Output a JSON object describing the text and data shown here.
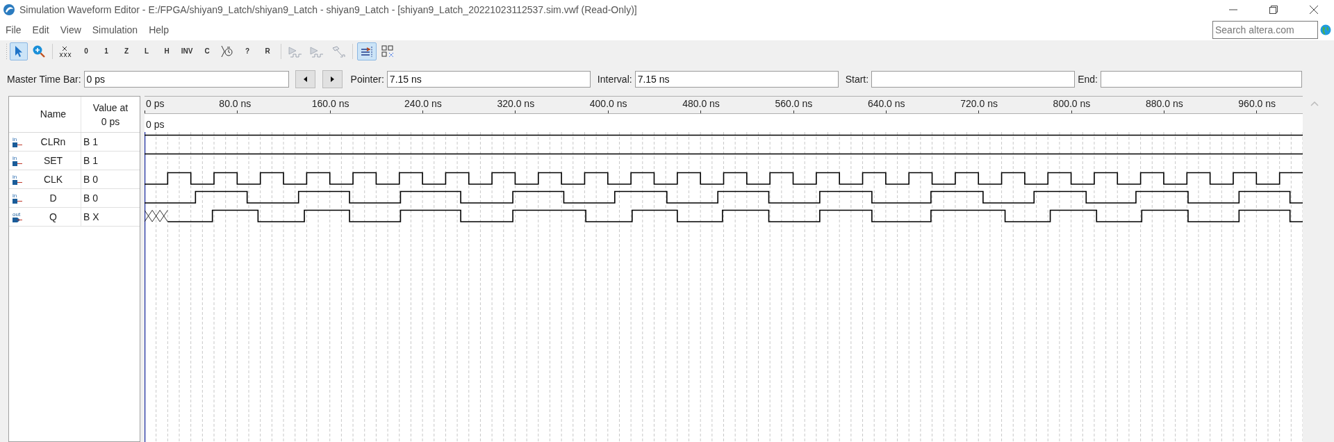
{
  "window": {
    "title": "Simulation Waveform Editor - E:/FPGA/shiyan9_Latch/shiyan9_Latch - shiyan9_Latch - [shiyan9_Latch_20221023112537.sim.vwf (Read-Only)]"
  },
  "menu": [
    "File",
    "Edit",
    "View",
    "Simulation",
    "Help"
  ],
  "search": {
    "placeholder": "Search altera.com"
  },
  "toolbar": [
    {
      "kind": "pointer",
      "selected": true,
      "disabled": false
    },
    {
      "kind": "zoom",
      "selected": false,
      "disabled": false
    },
    {
      "kind": "unknown",
      "selected": false,
      "disabled": false
    },
    {
      "kind": "glyph",
      "glyph": "0",
      "selected": false,
      "disabled": false
    },
    {
      "kind": "glyph",
      "glyph": "1",
      "selected": false,
      "disabled": false
    },
    {
      "kind": "glyph",
      "glyph": "Z",
      "selected": false,
      "disabled": false
    },
    {
      "kind": "glyph",
      "glyph": "L",
      "selected": false,
      "disabled": false
    },
    {
      "kind": "glyph",
      "glyph": "H",
      "selected": false,
      "disabled": false
    },
    {
      "kind": "glyph",
      "glyph": "INV",
      "selected": false,
      "disabled": false
    },
    {
      "kind": "glyph",
      "glyph": "C",
      "selected": false,
      "disabled": false
    },
    {
      "kind": "clock",
      "selected": false,
      "disabled": false
    },
    {
      "kind": "glyph",
      "glyph": "?",
      "selected": false,
      "disabled": false
    },
    {
      "kind": "glyph",
      "glyph": "R",
      "selected": false,
      "disabled": false
    },
    {
      "kind": "run",
      "selected": false,
      "disabled": true
    },
    {
      "kind": "run",
      "selected": false,
      "disabled": true
    },
    {
      "kind": "hammer",
      "selected": false,
      "disabled": true
    },
    {
      "kind": "snap",
      "selected": true,
      "disabled": false
    },
    {
      "kind": "grid",
      "selected": false,
      "disabled": false
    }
  ],
  "time_bar": {
    "master_label": "Master Time Bar:",
    "master_value": "0 ps",
    "pointer_label": "Pointer:",
    "pointer_value": "7.15 ns",
    "interval_label": "Interval:",
    "interval_value": "7.15 ns",
    "start_label": "Start:",
    "end_label": "End:"
  },
  "columns": {
    "name": "Name",
    "value": "Value at 0 ps"
  },
  "time_axis": [
    "0 ps",
    "80.0 ns",
    "160.0 ns",
    "240.0 ns",
    "320.0 ns",
    "400.0 ns",
    "480.0 ns",
    "560.0 ns",
    "640.0 ns",
    "720.0 ns",
    "800.0 ns",
    "880.0 ns",
    "960.0 ns"
  ],
  "master_marker": "0 ps",
  "signals": [
    {
      "io": "in",
      "name": "CLRn",
      "value": "B 1"
    },
    {
      "io": "in",
      "name": "SET",
      "value": "B 1"
    },
    {
      "io": "in",
      "name": "CLK",
      "value": "B 0"
    },
    {
      "io": "in",
      "name": "D",
      "value": "B 0"
    },
    {
      "io": "out",
      "name": "Q",
      "value": "B X"
    }
  ]
}
